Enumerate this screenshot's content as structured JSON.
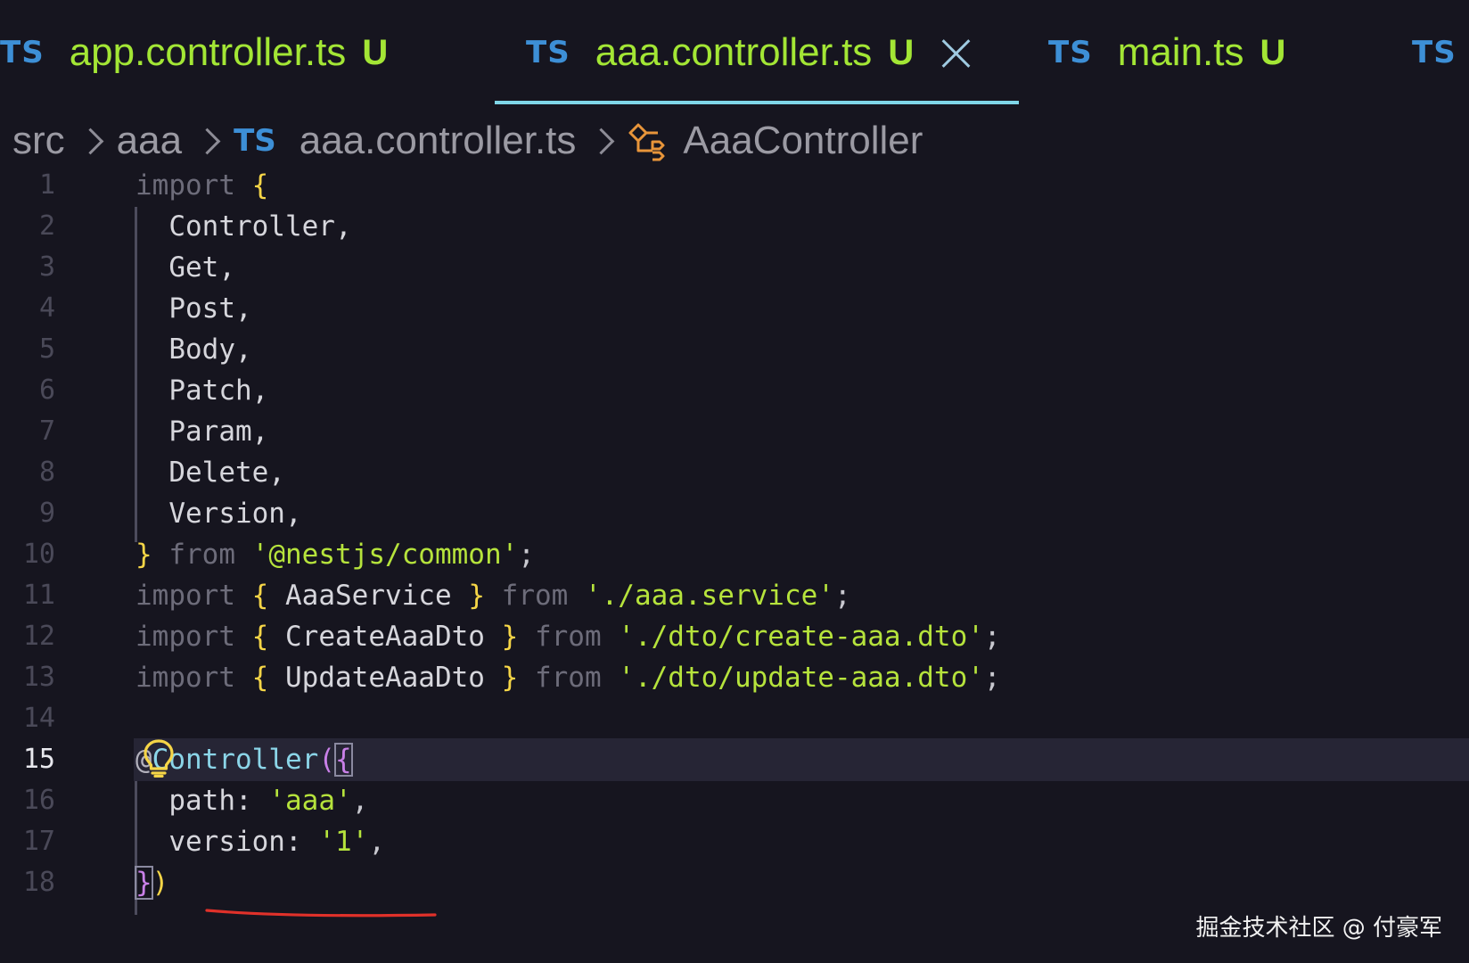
{
  "tabs": [
    {
      "badge": "TS",
      "name": "app.controller.ts",
      "status": "U",
      "active": false
    },
    {
      "badge": "TS",
      "name": "aaa.controller.ts",
      "status": "U",
      "active": true
    },
    {
      "badge": "TS",
      "name": "main.ts",
      "status": "U",
      "active": false
    },
    {
      "badge": "TS",
      "name": "",
      "status": "",
      "active": false
    }
  ],
  "breadcrumb": {
    "items": [
      "src",
      "aaa"
    ],
    "file_badge": "TS",
    "file": "aaa.controller.ts",
    "symbol": "AaaController",
    "symbol_icon": "class-icon"
  },
  "editor": {
    "active_line": 15,
    "line_numbers": [
      "1",
      "2",
      "3",
      "4",
      "5",
      "6",
      "7",
      "8",
      "9",
      "10",
      "11",
      "12",
      "13",
      "14",
      "15",
      "16",
      "17",
      "18"
    ],
    "lines": {
      "l1": {
        "import": "import",
        "brace": "{"
      },
      "l2": "Controller,",
      "l3": "Get,",
      "l4": "Post,",
      "l5": "Body,",
      "l6": "Patch,",
      "l7": "Param,",
      "l8": "Delete,",
      "l9": "Version,",
      "l10": {
        "brace": "}",
        "from": "from",
        "module": "'@nestjs/common'",
        "semi": ";"
      },
      "l11": {
        "import": "import",
        "open": "{",
        "name": "AaaService",
        "close": "}",
        "from": "from",
        "module": "'./aaa.service'",
        "semi": ";"
      },
      "l12": {
        "import": "import",
        "open": "{",
        "name": "CreateAaaDto",
        "close": "}",
        "from": "from",
        "module": "'./dto/create-aaa.dto'",
        "semi": ";"
      },
      "l13": {
        "import": "import",
        "open": "{",
        "name": "UpdateAaaDto",
        "close": "}",
        "from": "from",
        "module": "'./dto/update-aaa.dto'",
        "semi": ";"
      },
      "l15": {
        "at": "@",
        "decorator": "Controller",
        "paren": "(",
        "brace": "{"
      },
      "l16": {
        "key": "path:",
        "value": "'aaa'",
        "comma": ","
      },
      "l17": {
        "key": "version:",
        "value": "'1'",
        "comma": ","
      },
      "l18": {
        "brace": "}",
        "paren": ")"
      }
    },
    "lightbulb_line": 14
  },
  "watermark": "掘金技术社区 @ 付豪军",
  "colors": {
    "background": "#16151f",
    "ts_badge": "#3d8fd6",
    "tab_text": "#a3e635",
    "active_tab_underline": "#7fd6e8",
    "string": "#b6e33c",
    "bracket": "#f5d547",
    "keyword": "#6d6c7a",
    "decorator": "#8bd5e8",
    "annotation_underline": "#e0312a"
  }
}
